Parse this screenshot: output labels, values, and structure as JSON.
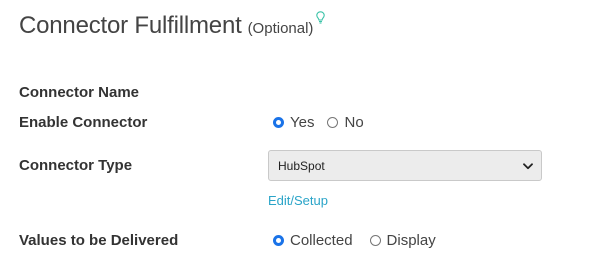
{
  "header": {
    "title": "Connector Fulfillment",
    "subtitle": "(Optional)",
    "hint_icon": "lightbulb-icon"
  },
  "form": {
    "connector_name": {
      "label": "Connector Name"
    },
    "enable_connector": {
      "label": "Enable Connector",
      "options": [
        {
          "label": "Yes",
          "checked": true
        },
        {
          "label": "No",
          "checked": false
        }
      ]
    },
    "connector_type": {
      "label": "Connector Type",
      "selected": "HubSpot",
      "dropdown_icon": "chevron-down-icon"
    },
    "edit_setup_link": "Edit/Setup",
    "values_delivered": {
      "label": "Values to be Delivered",
      "options": [
        {
          "label": "Collected",
          "checked": true
        },
        {
          "label": "Display",
          "checked": false
        }
      ]
    }
  },
  "colors": {
    "accent": "#1a73e8",
    "link": "#2aa4c8",
    "hint_icon": "#3cc3a8"
  }
}
